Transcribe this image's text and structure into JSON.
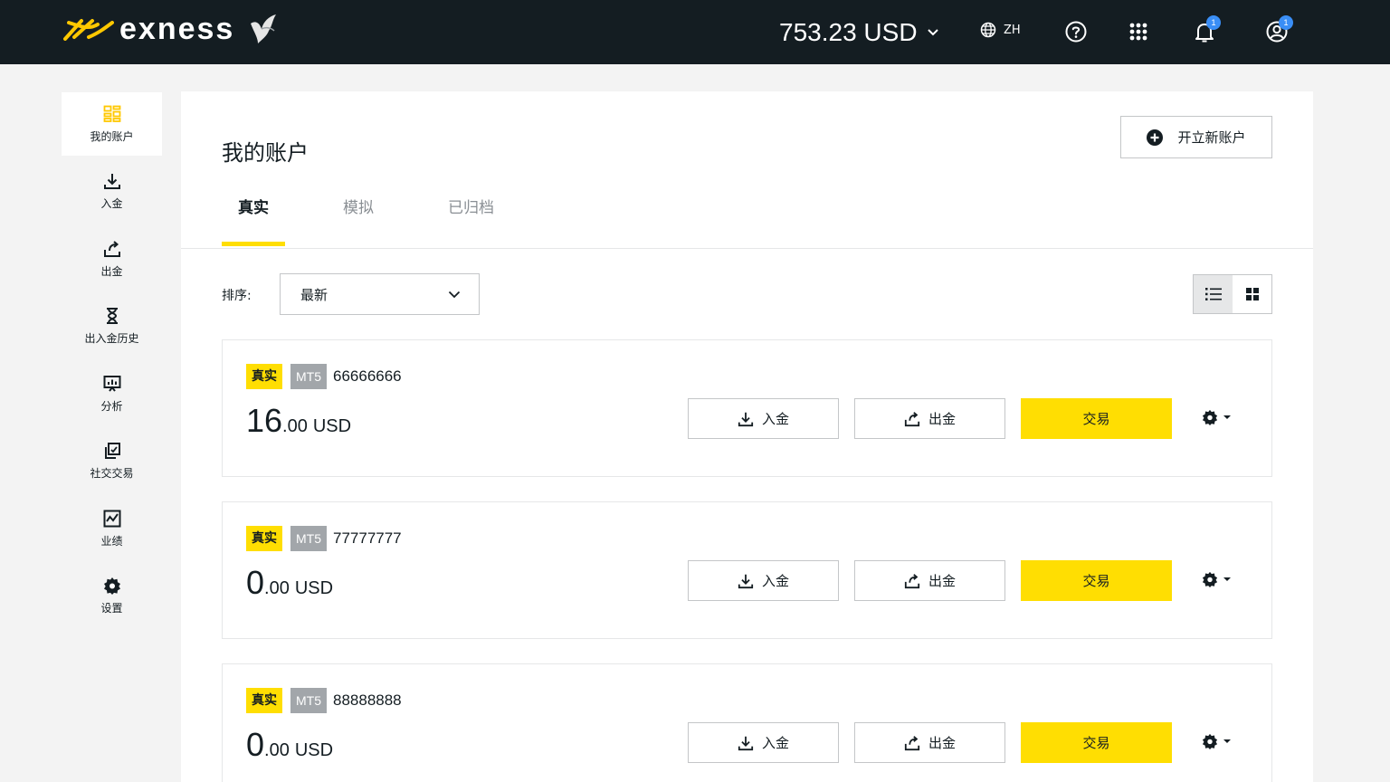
{
  "header": {
    "brand": "exness",
    "balance": "753.23 USD",
    "language": "ZH",
    "notifications_badge": "1",
    "profile_badge": "1"
  },
  "sidebar": {
    "items": [
      {
        "label": "我的账户",
        "icon": "dashboard-icon",
        "active": true
      },
      {
        "label": "入金",
        "icon": "download-icon"
      },
      {
        "label": "出金",
        "icon": "upload-icon"
      },
      {
        "label": "出入金历史",
        "icon": "hourglass-icon"
      },
      {
        "label": "分析",
        "icon": "analytics-icon"
      },
      {
        "label": "社交交易",
        "icon": "copy-icon"
      },
      {
        "label": "业绩",
        "icon": "chart-icon"
      },
      {
        "label": "设置",
        "icon": "gear-icon"
      }
    ]
  },
  "main": {
    "title": "我的账户",
    "new_account_label": "开立新账户",
    "tabs": [
      {
        "label": "真实",
        "active": true
      },
      {
        "label": "模拟"
      },
      {
        "label": "已归档"
      }
    ],
    "sort_label": "排序:",
    "sort_value": "最新",
    "accounts": [
      {
        "type": "真实",
        "platform": "MT5",
        "number": "66666666",
        "balance_int": "16",
        "balance_dec": ".00",
        "currency": "USD",
        "deposit": "入金",
        "withdraw": "出金",
        "trade": "交易"
      },
      {
        "type": "真实",
        "platform": "MT5",
        "number": "77777777",
        "balance_int": "0",
        "balance_dec": ".00",
        "currency": "USD",
        "deposit": "入金",
        "withdraw": "出金",
        "trade": "交易"
      },
      {
        "type": "真实",
        "platform": "MT5",
        "number": "88888888",
        "balance_int": "0",
        "balance_dec": ".00",
        "currency": "USD",
        "deposit": "入金",
        "withdraw": "出金",
        "trade": "交易"
      }
    ]
  },
  "colors": {
    "brand_yellow": "#ffde02",
    "header_bg": "#141d22",
    "badge_blue": "#3a8ef6"
  }
}
